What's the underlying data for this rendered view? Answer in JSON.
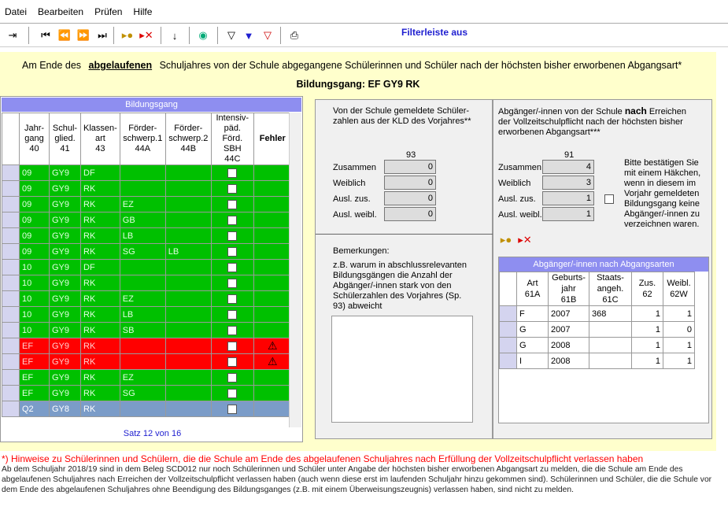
{
  "menu": [
    "Datei",
    "Bearbeiten",
    "Prüfen",
    "Hilfe"
  ],
  "toolbar": {
    "filter_label": "Filterleiste aus"
  },
  "heading": {
    "pre": "Am Ende des",
    "emph": "abgelaufenen",
    "post": "Schuljahres von der Schule abgegangene Schülerinnen und Schüler nach der höchsten bisher erworbenen Abgangsart*",
    "bildungsgang": "Bildungsgang: EF GY9 RK"
  },
  "left": {
    "title": "Bildungsgang",
    "cols": [
      "Jahr-\ngang\n40",
      "Schul-\nglied.\n41",
      "Klassen-\nart\n43",
      "Förder-\nschwerp.1\n44A",
      "Förder-\nschwerp.2\n44B",
      "Intensiv-\npäd. Förd.\nSBH\n44C",
      "Fehler"
    ],
    "rows": [
      [
        "09",
        "GY9",
        "DF",
        "",
        "",
        "g"
      ],
      [
        "09",
        "GY9",
        "RK",
        "",
        "",
        "g"
      ],
      [
        "09",
        "GY9",
        "RK",
        "EZ",
        "",
        "g"
      ],
      [
        "09",
        "GY9",
        "RK",
        "GB",
        "",
        "g"
      ],
      [
        "09",
        "GY9",
        "RK",
        "LB",
        "",
        "g"
      ],
      [
        "09",
        "GY9",
        "RK",
        "SG",
        "LB",
        "g"
      ],
      [
        "10",
        "GY9",
        "DF",
        "",
        "",
        "g"
      ],
      [
        "10",
        "GY9",
        "RK",
        "",
        "",
        "g"
      ],
      [
        "10",
        "GY9",
        "RK",
        "EZ",
        "",
        "g"
      ],
      [
        "10",
        "GY9",
        "RK",
        "LB",
        "",
        "g"
      ],
      [
        "10",
        "GY9",
        "RK",
        "SB",
        "",
        "g"
      ],
      [
        "EF",
        "GY9",
        "RK",
        "",
        "",
        "r"
      ],
      [
        "EF",
        "GY9",
        "RK",
        "",
        "",
        "r"
      ],
      [
        "EF",
        "GY9",
        "RK",
        "EZ",
        "",
        "g"
      ],
      [
        "EF",
        "GY9",
        "RK",
        "SG",
        "",
        "g"
      ],
      [
        "Q2",
        "GY8",
        "RK",
        "",
        "",
        "p"
      ]
    ],
    "status": "Satz 12 von 16"
  },
  "mid": {
    "intro": "Von der Schule gemeldete Schüler-zahlen aus der KLD des Vorjahres**",
    "col": "93",
    "labels": [
      "Zusammen",
      "Weiblich",
      "Ausl. zus.",
      "Ausl. weibl."
    ],
    "values": [
      "0",
      "0",
      "0",
      "0"
    ],
    "remarks_title": "Bemerkungen:",
    "remarks_text": "z.B. warum in abschlussrelevanten Bildungsgängen die Anzahl der Abgänger/-innen stark von den Schülerzahlen des Vorjahres (Sp. 93) abweicht"
  },
  "right": {
    "intro_a": "Abgänger/-innen von der Schule ",
    "intro_b": "nach",
    "intro_c": " Erreichen der Vollzeitschulpflicht nach der höchsten bisher erworbenen Abgangsart***",
    "col": "91",
    "labels": [
      "Zusammen",
      "Weiblich",
      "Ausl. zus.",
      "Ausl. weibl."
    ],
    "values": [
      "4",
      "3",
      "1",
      "1"
    ],
    "confirm": "Bitte bestätigen Sie mit einem Häkchen, wenn in diesem im Vorjahr gemeldeten Bildungsgang keine Abgänger/-innen zu verzeichnen waren.",
    "table_title": "Abgänger/-innen nach Abgangsarten",
    "cols": [
      "Art\n61A",
      "Geburts-\njahr\n61B",
      "Staats-\nangeh.\n61C",
      "Zus.\n62",
      "Weibl.\n62W"
    ],
    "rows": [
      [
        "F",
        "2007",
        "368",
        "1",
        "1"
      ],
      [
        "G",
        "2007",
        "",
        "1",
        "0"
      ],
      [
        "G",
        "2008",
        "",
        "1",
        "1"
      ],
      [
        "I",
        "2008",
        "",
        "1",
        "1"
      ]
    ]
  },
  "footer": {
    "line1": "*) Hinweise zu Schülerinnen und Schülern, die die Schule am Ende des abgelaufenen Schuljahres nach  Erfüllung der Vollzeitschulpflicht verlassen haben",
    "line2": "Ab dem Schuljahr 2018/19 sind in dem Beleg SCD012 nur noch Schülerinnen und Schüler unter Angabe der höchsten bisher erworbenen Abgangsart zu melden, die die Schule am Ende des abgelaufenen Schuljahres nach Erreichen der Vollzeitschulpflicht verlassen haben (auch wenn diese erst im laufenden Schuljahr hinzu gekommen sind). Schülerinnen und Schüler, die die Schule vor dem Ende des abgelaufenen Schuljahres ohne Beendigung des Bildungsganges (z.B. mit einem Überweisungszeugnis) verlassen haben, sind nicht zu melden."
  }
}
